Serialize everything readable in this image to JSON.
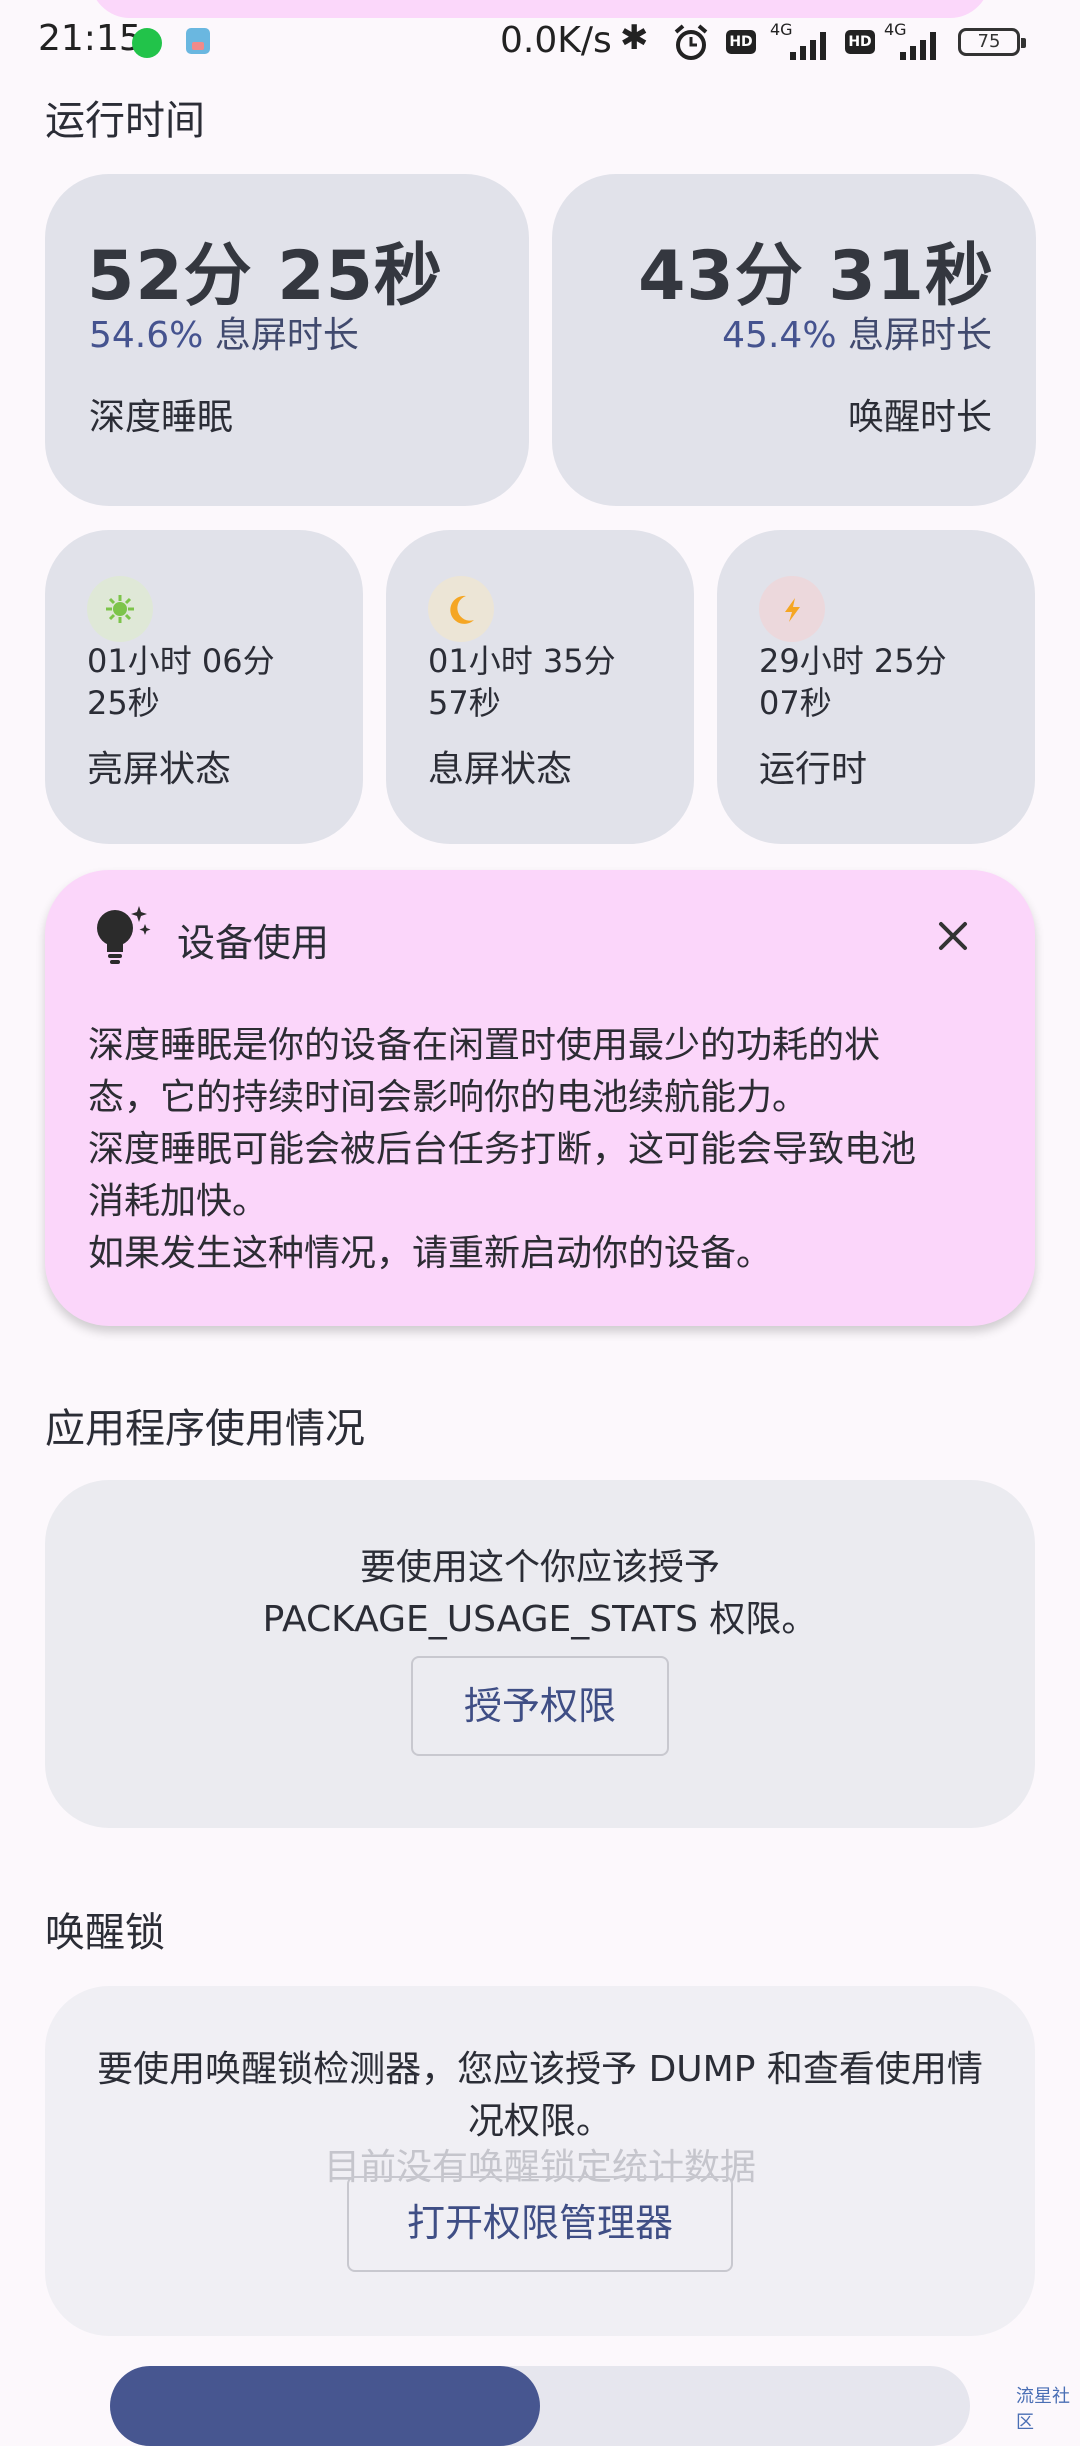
{
  "status_bar": {
    "time": "21:15",
    "net_speed": "0.0K/s",
    "hd1": "HD",
    "net1": "4G",
    "hd2": "HD",
    "net2": "4G",
    "battery": "75"
  },
  "uptime": {
    "title": "运行时间",
    "deep_sleep": {
      "value": "52分 25秒",
      "percent": "54.6%",
      "percent_label": "息屏时长",
      "label": "深度睡眠"
    },
    "awake": {
      "value": "43分 31秒",
      "percent": "45.4%",
      "percent_label": "息屏时长",
      "label": "唤醒时长"
    },
    "screen_on": {
      "value": "01小时 06分 25秒",
      "label": "亮屏状态"
    },
    "screen_off": {
      "value": "01小时 35分 57秒",
      "label": "息屏状态"
    },
    "running": {
      "value": "29小时 25分 07秒",
      "label": "运行时"
    }
  },
  "tip": {
    "title": "设备使用",
    "lines": [
      "深度睡眠是你的设备在闲置时使用最少的功耗的状",
      "态，它的持续时间会影响你的电池续航能力。",
      "深度睡眠可能会被后台任务打断，这可能会导致电池",
      "消耗加快。",
      "如果发生这种情况，请重新启动你的设备。"
    ]
  },
  "app_usage": {
    "title": "应用程序使用情况",
    "message_line1": "要使用这个你应该授予",
    "message_line2": "PACKAGE_USAGE_STATS 权限。",
    "button": "授予权限"
  },
  "wakelock": {
    "title": "唤醒锁",
    "message_line1": "要使用唤醒锁检测器，您应该授予 DUMP 和查看使用情",
    "message_line2": "况权限。",
    "empty": "目前没有唤醒锁定统计数据",
    "button": "打开权限管理器"
  },
  "watermark": "流星社区",
  "colors": {
    "accent": "#475690",
    "card": "#e1e2ea",
    "tip_bg": "#fbd6fa",
    "sun": "#7cc44a",
    "moon": "#f5a623",
    "bolt": "#f5a623"
  },
  "icons": [
    "bluetooth-icon",
    "alarm-icon",
    "sun-icon",
    "moon-icon",
    "bolt-icon",
    "lightbulb-icon",
    "close-icon"
  ]
}
